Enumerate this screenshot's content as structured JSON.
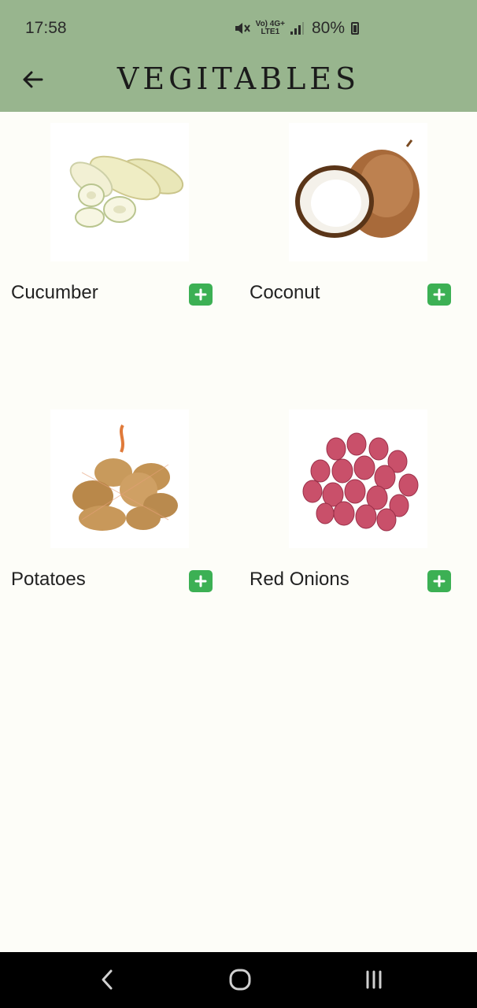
{
  "status_bar": {
    "time": "17:58",
    "network_top": "Vo) 4G+",
    "network_bottom": "LTE1",
    "battery_percent": "80%"
  },
  "header": {
    "title": "VEGITABLES",
    "background_color": "#98b58e"
  },
  "products": [
    {
      "name": "Cucumber"
    },
    {
      "name": "Coconut"
    },
    {
      "name": "Potatoes"
    },
    {
      "name": "Red Onions"
    }
  ],
  "accent_color": "#3cb054",
  "icons": {
    "back": "arrow-left-icon",
    "add": "plus-icon",
    "nav_back": "chevron-left-icon",
    "nav_home": "home-circle-icon",
    "nav_recents": "recents-bars-icon"
  }
}
